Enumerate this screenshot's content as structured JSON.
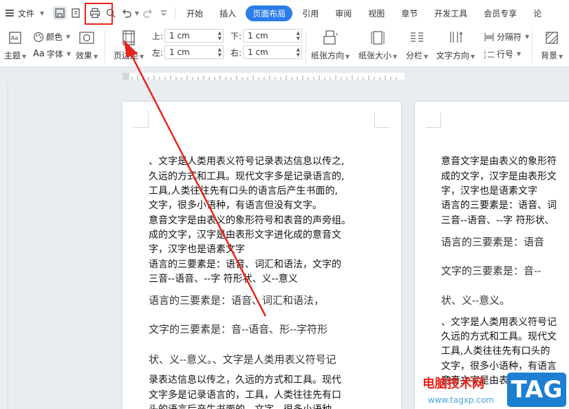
{
  "quick_access": {
    "file_label": "文件"
  },
  "tabs": [
    {
      "label": "开始",
      "active": false
    },
    {
      "label": "插入",
      "active": false
    },
    {
      "label": "页面布局",
      "active": true
    },
    {
      "label": "引用",
      "active": false
    },
    {
      "label": "审阅",
      "active": false
    },
    {
      "label": "视图",
      "active": false
    },
    {
      "label": "章节",
      "active": false
    },
    {
      "label": "开发工具",
      "active": false
    },
    {
      "label": "会员专享",
      "active": false
    },
    {
      "label": "论",
      "active": false
    }
  ],
  "ribbon": {
    "theme_label": "主题",
    "color_label": "颜色",
    "font_label": "字体",
    "effect_label": "效果",
    "margins_label": "页边距",
    "margin_top_label": "上:",
    "margin_top_value": "1 cm",
    "margin_bottom_label": "下:",
    "margin_bottom_value": "1 cm",
    "margin_left_label": "左:",
    "margin_left_value": "1 cm",
    "margin_right_label": "右:",
    "margin_right_value": "1 cm",
    "orientation_label": "纸张方向",
    "size_label": "纸张大小",
    "columns_label": "分栏",
    "text_direction_label": "文字方向",
    "separator_label": "分隔符",
    "line_number_label": "行号",
    "background_label": "背景"
  },
  "colors": {
    "accent": "#2b7de9",
    "annotation": "#e8231a"
  },
  "page1": {
    "lines": [
      "、文字是人类用表义符号记录表达信息以传之,",
      "久远的方式和工具。现代文字多是记录语言的,",
      "工具,人类往往先有口头的语言后产生书面的,",
      "文字，很多小语种，有语言但没有文字。",
      "意音文字是由表义的象形符号和表音的声旁组。",
      "成的文字，汉字是由表形文字进化成的意音文",
      "字，汉字也是语素文字",
      "语言的三要素是：语音、词汇和语法，文字的",
      "三音--语音、--字  符形状、义--意义"
    ],
    "serif_lines": [
      "语言的三要素是：语音、词汇和语法，",
      "文字的三要素是：音--语音、形--字符形",
      "状、义--意义。、文字是人类用表义符号记"
    ],
    "tail_lines": [
      "录表达信息以传之，久远的方式和工具。现代",
      "文字多是记录语言的，工具，人类往往先有口",
      "头的语言后产生书面的，文字，很多小语种"
    ]
  },
  "page2": {
    "lines": [
      "意音文字是由表义的象形符",
      "成的文字，汉字是由表形文",
      "字，汉字也是语素文字",
      "语言的三要素是：语音、词",
      "三音--语音、--字  符形状、"
    ],
    "serif_lines": [
      "语言的三要素是：语音",
      "文字的三要素是：音--",
      "状、义--意义。"
    ],
    "tail_lines": [
      "、文字是人类用表义符号记",
      "久远的方式和工具。现代文",
      "工具,人类往往先有口头的",
      "文字，很多小语种，有语言",
      "意音文字是由表义的象形符"
    ]
  },
  "watermark": {
    "title": "电脑技术网",
    "url": "www.tagxp.com",
    "logo": "TAG"
  }
}
